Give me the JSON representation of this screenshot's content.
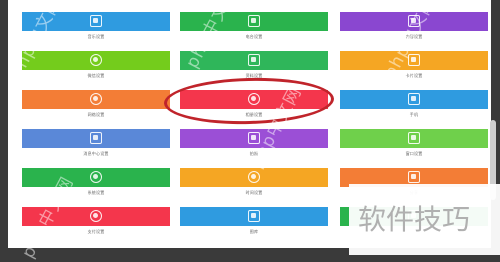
{
  "tiles": [
    {
      "color": "#2f9be0",
      "icon": "music-icon",
      "label": "音乐设置"
    },
    {
      "color": "#2ab34d",
      "icon": "note-icon",
      "label": "电台设置"
    },
    {
      "color": "#8a47d0",
      "icon": "book-icon",
      "label": "内容设置"
    },
    {
      "color": "#74cc1c",
      "icon": "chat-icon",
      "label": "微信设置"
    },
    {
      "color": "#2fb65a",
      "icon": "document-icon",
      "label": "资料设置"
    },
    {
      "color": "#f5a623",
      "icon": "card-icon",
      "label": "卡片设置"
    },
    {
      "color": "#f37d36",
      "icon": "globe-icon",
      "label": "网络设置"
    },
    {
      "color": "#f4364c",
      "icon": "photo-icon",
      "label": "相册设置"
    },
    {
      "color": "#2f9be0",
      "icon": "phone-icon",
      "label": "手机"
    },
    {
      "color": "#5a88d8",
      "icon": "message-icon",
      "label": "消息中心设置"
    },
    {
      "color": "#9b4fd6",
      "icon": "camera-icon",
      "label": "拍照"
    },
    {
      "color": "#6fd04b",
      "icon": "window-icon",
      "label": "窗口设置"
    },
    {
      "color": "#2ab34d",
      "icon": "settings-icon",
      "label": "系统设置"
    },
    {
      "color": "#f5a623",
      "icon": "clock-icon",
      "label": "时间设置"
    },
    {
      "color": "#f37d36",
      "icon": "share-icon",
      "label": "分享"
    },
    {
      "color": "#f4364c",
      "icon": "money-icon",
      "label": "支付设置"
    },
    {
      "color": "#2f9be0",
      "icon": "gallery-icon",
      "label": "图库"
    },
    {
      "color": "#2ab34d",
      "icon": "tile-icon",
      "label": ""
    }
  ],
  "watermark": "php中文网",
  "brand": "软件技巧",
  "highlight_color": "#c0242b"
}
